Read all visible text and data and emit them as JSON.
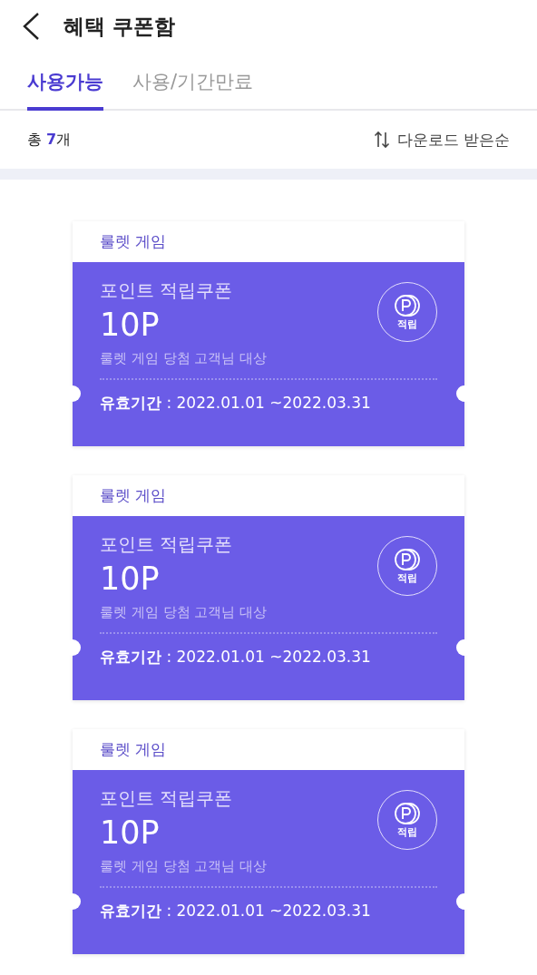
{
  "header": {
    "title": "혜택 쿠폰함"
  },
  "tabs": [
    {
      "label": "사용가능",
      "selected": true
    },
    {
      "label": "사용/기간만료",
      "selected": false
    }
  ],
  "summary": {
    "total_label": "총",
    "total_count": "7",
    "unit": "개",
    "sort": "다운로드 받은순"
  },
  "coupons": [
    {
      "category": "룰렛 게임",
      "name": "포인트 적립쿠폰",
      "amount": "10P",
      "condition": "룰렛 게임 당첨 고객님 대상",
      "validity": "**유효기간** : 2022.01.01 ~2022.03.31",
      "badge": "적립"
    },
    {
      "category": "룰렛 게임",
      "name": "포인트 적립쿠폰",
      "amount": "10P",
      "condition": "룰렛 게임 당첨 고객님 대상",
      "validity": "**유효기간** : 2022.01.01 ~2022.03.31",
      "badge": "적립"
    },
    {
      "category": "룰렛 게임",
      "name": "포인트 적립쿠폰",
      "amount": "10P",
      "condition": "룰렛 게임 당첨 고객님 대상",
      "validity": "**유효기간** : 2022.01.01 ~2022.03.31",
      "badge": "적립"
    }
  ]
}
